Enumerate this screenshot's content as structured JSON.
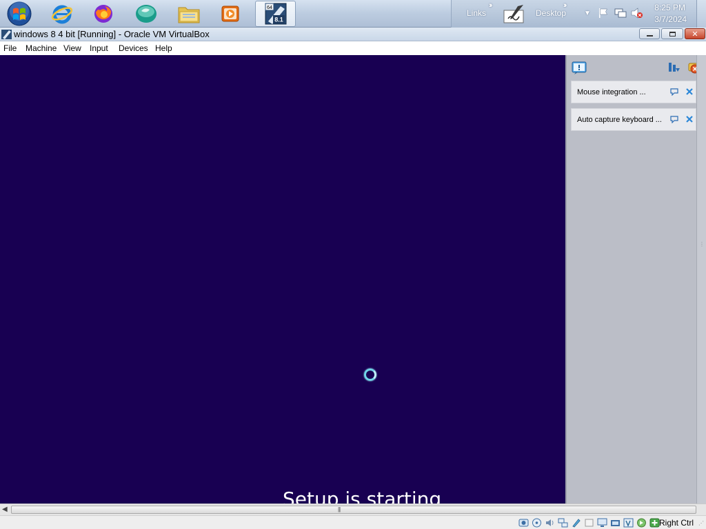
{
  "taskbar": {
    "pinned": [
      {
        "name": "start-orb-icon"
      },
      {
        "name": "internet-explorer-icon"
      },
      {
        "name": "firefox-icon"
      },
      {
        "name": "app-globe-icon"
      },
      {
        "name": "file-explorer-icon"
      },
      {
        "name": "media-player-icon"
      },
      {
        "name": "virtualbox-vm-icon",
        "badge_top": "64",
        "badge_bottom": "8.1"
      }
    ],
    "links_label": "Links",
    "desktop_label": "Desktop",
    "clock": {
      "time": "8:25 PM",
      "date": "3/7/2024"
    }
  },
  "window": {
    "title": "windows 8 4 bit [Running] - Oracle VM VirtualBox"
  },
  "menu": [
    "File",
    "Machine",
    "View",
    "Input",
    "Devices",
    "Help"
  ],
  "vm": {
    "setup_text": "Setup is starting",
    "background": "#180052"
  },
  "notifications": [
    {
      "text": "Mouse integration ..."
    },
    {
      "text": "Auto capture keyboard ..."
    }
  ],
  "statusbar": {
    "host_key": "Right Ctrl"
  }
}
